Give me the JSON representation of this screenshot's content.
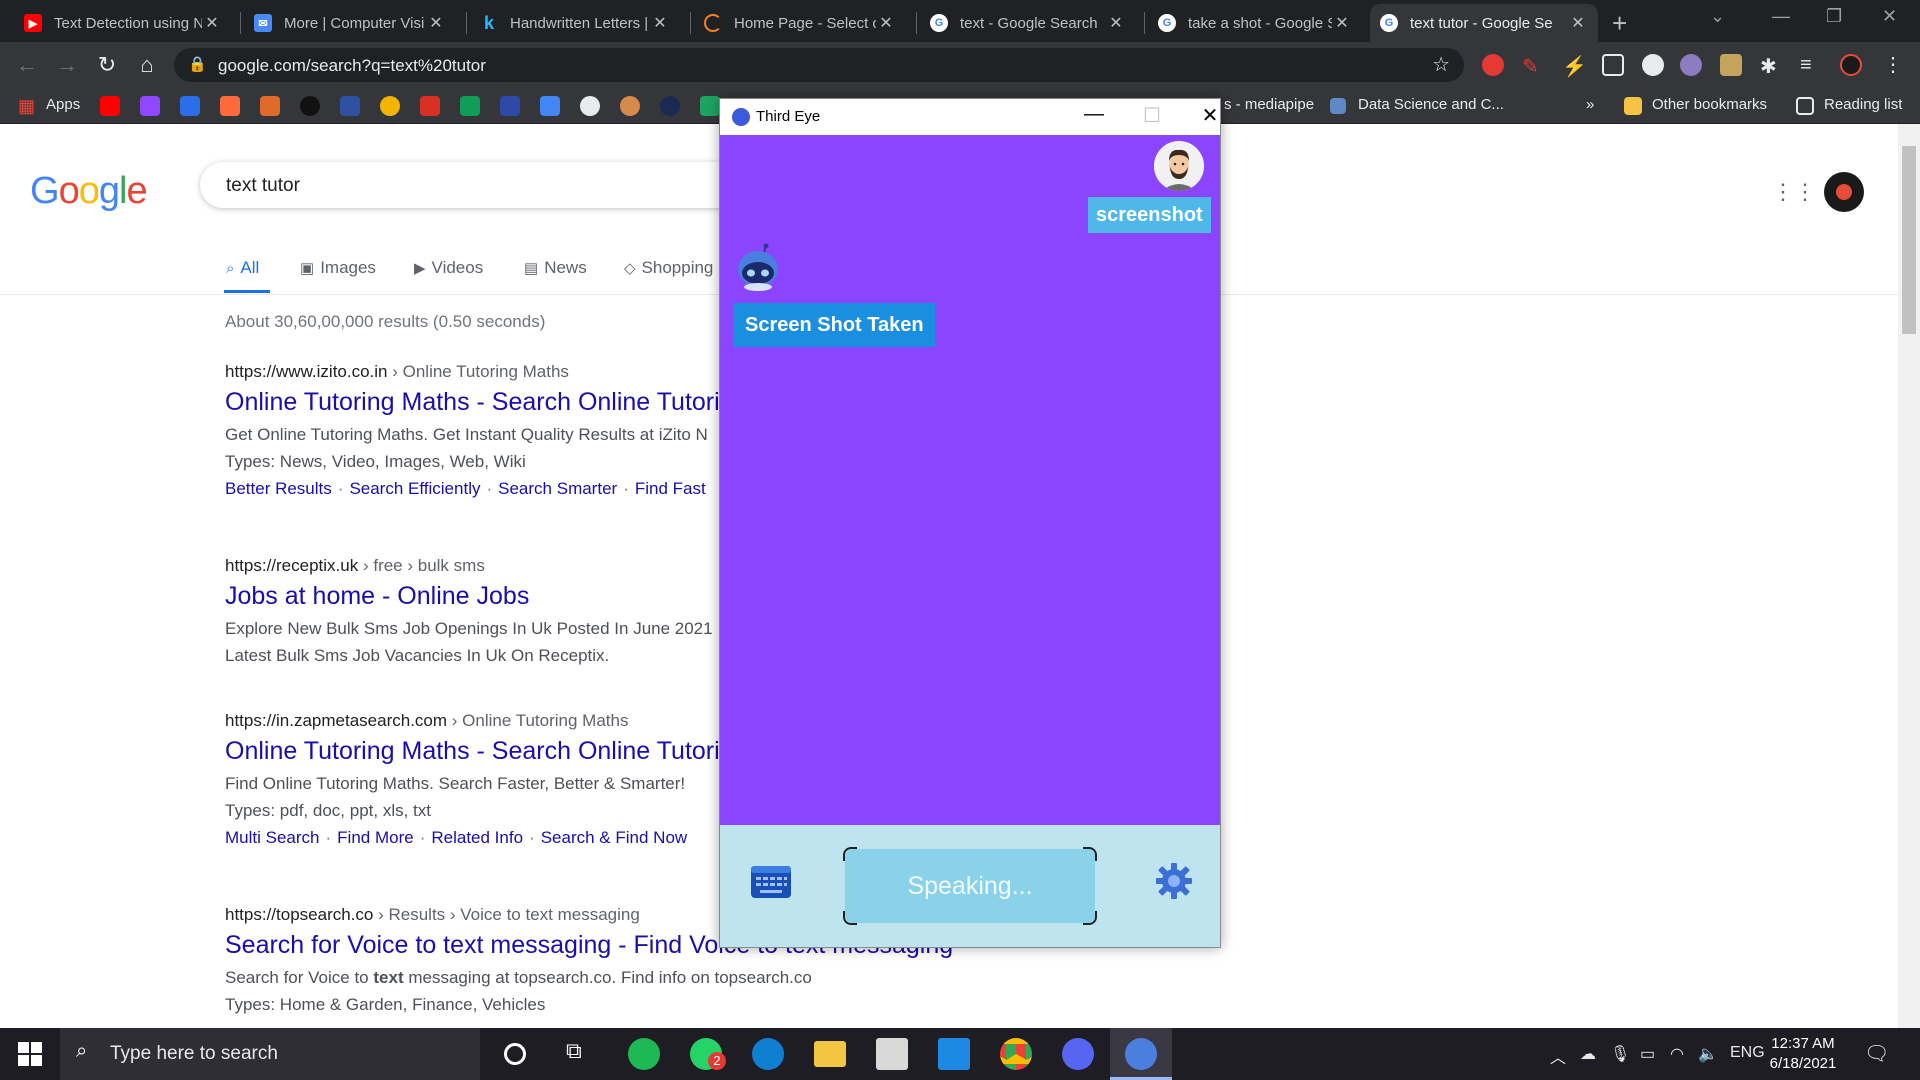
{
  "browser": {
    "tabs": [
      {
        "title": "Text Detection using N",
        "favicon": "youtube-icon",
        "color": "#ff0000"
      },
      {
        "title": "More | Computer Visi",
        "favicon": "mail-icon",
        "color": "#4a8af4"
      },
      {
        "title": "Handwritten Letters | I",
        "favicon": "k-icon",
        "color": "#20beff"
      },
      {
        "title": "Home Page - Select o",
        "favicon": "loading-icon",
        "color": "#f48024"
      },
      {
        "title": "text - Google Search",
        "favicon": "google-icon",
        "color": "#ffffff"
      },
      {
        "title": "take a shot - Google S",
        "favicon": "google-icon",
        "color": "#ffffff"
      },
      {
        "title": "text tutor - Google Se",
        "favicon": "google-icon",
        "color": "#ffffff",
        "active": true
      }
    ],
    "url": "google.com/search?q=text%20tutor",
    "bookmarks": {
      "apps": "Apps",
      "mediapipe": "s - mediapipe",
      "datascience": "Data Science and C...",
      "more": "»",
      "other": "Other bookmarks",
      "reading": "Reading list"
    }
  },
  "google": {
    "logo": "Google",
    "query": "text tutor",
    "tabs": {
      "all": "All",
      "images": "Images",
      "videos": "Videos",
      "news": "News",
      "shopping": "Shopping"
    },
    "stats": "About 30,60,00,000 results (0.50 seconds)",
    "results": [
      {
        "site": "https://www.izito.co.in",
        "crumb": " › Online Tutoring Maths",
        "title": "Online Tutoring Maths - Search Online Tutoring",
        "snippet1": "Get Online Tutoring Maths. Get Instant Quality Results at iZito N",
        "snippet2": "Types: News, Video, Images, Web, Wiki",
        "links": [
          "Better Results",
          "Search Efficiently",
          "Search Smarter",
          "Find Fast"
        ]
      },
      {
        "site": "https://receptix.uk",
        "crumb": " › free › bulk sms",
        "title": "Jobs at home - Online Jobs",
        "snippet1": "Explore New Bulk Sms Job Openings In Uk Posted In June 2021",
        "snippet2": "Latest Bulk Sms Job Vacancies In Uk On Receptix."
      },
      {
        "site": "https://in.zapmetasearch.com",
        "crumb": " › Online Tutoring Maths",
        "title": "Online Tutoring Maths - Search Online Tutoring",
        "snippet1": "Find Online Tutoring Maths. Search Faster, Better & Smarter!",
        "snippet2": "Types: pdf, doc, ppt, xls, txt",
        "links": [
          "Multi Search",
          "Find More",
          "Related Info",
          "Search & Find Now"
        ]
      },
      {
        "site": "https://topsearch.co",
        "crumb": " › Results › Voice to text messaging",
        "title": "Search for Voice to text messaging - Find Voice to text messaging",
        "snippet1_pre": "Search for Voice to ",
        "snippet1_bold": "text",
        "snippet1_post": " messaging at topsearch.co. Find info on topsearch.co",
        "snippet2": "Types: Home & Garden, Finance, Vehicles"
      }
    ]
  },
  "thirdeye": {
    "title": "Third Eye",
    "user_message": "screenshot",
    "bot_message": "Screen Shot Taken",
    "speak_label": "Speaking...",
    "chat_bg": "#8b45ff",
    "bottom_bg": "#bde4ef"
  },
  "taskbar": {
    "search_placeholder": "Type here to search",
    "whatsapp_badge": "2",
    "lang": "ENG",
    "time": "12:37 AM",
    "date": "6/18/2021"
  }
}
